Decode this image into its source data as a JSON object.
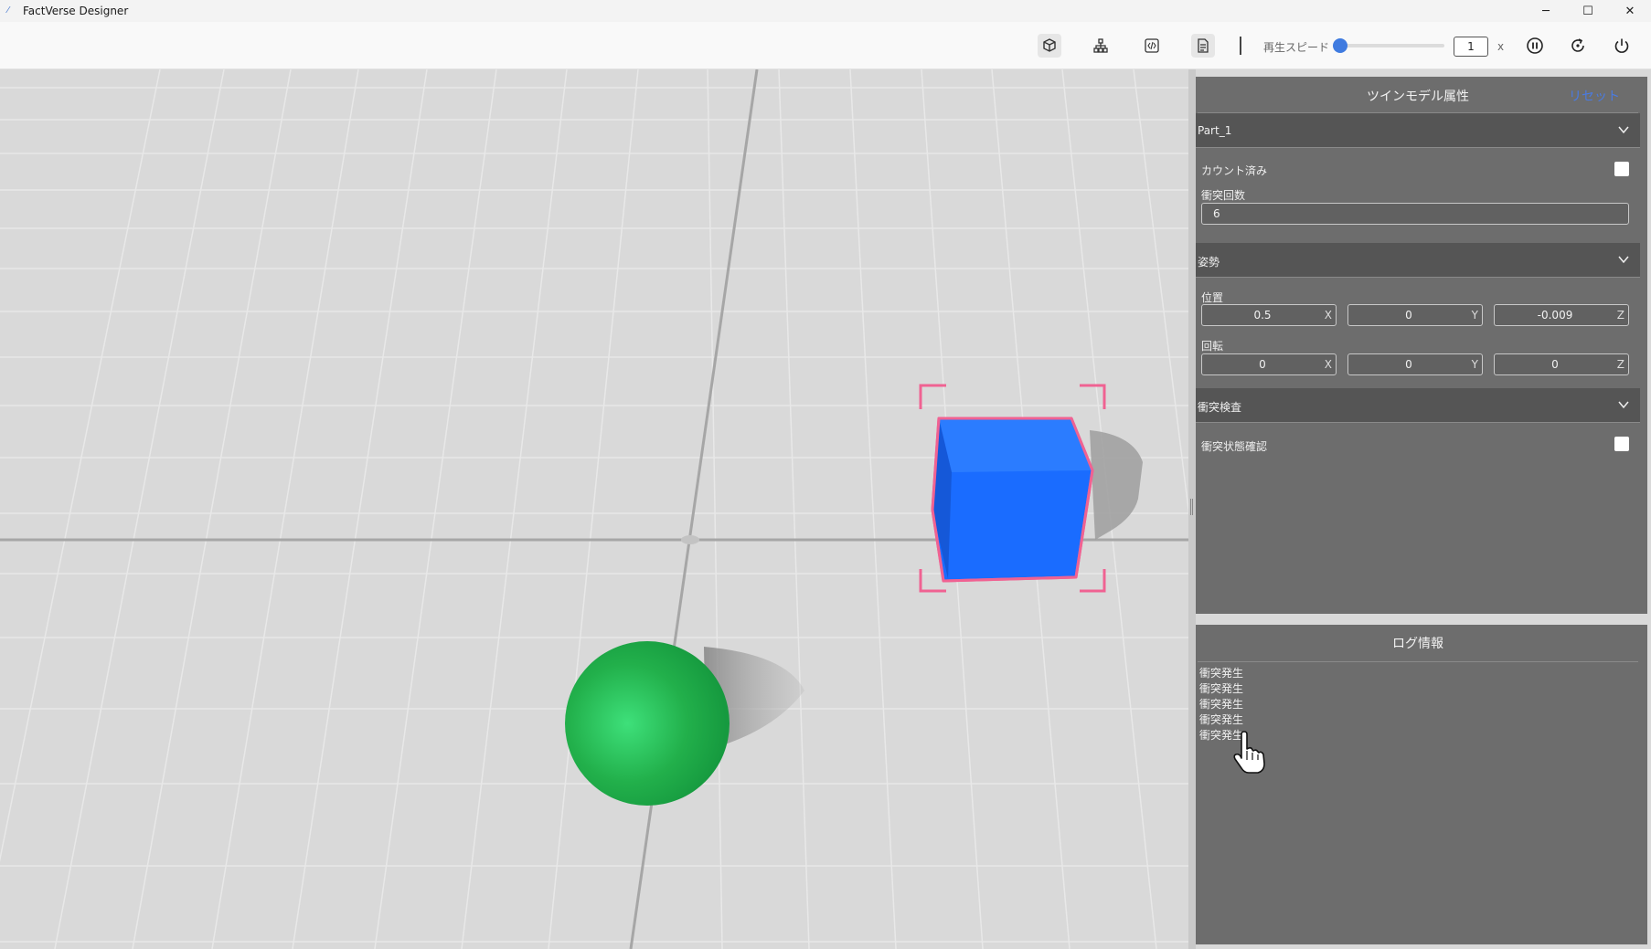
{
  "window": {
    "title": "FactVerse Designer",
    "icon": "factverse-logo-icon",
    "controls": {
      "minimize": "─",
      "maximize": "☐",
      "close": "✕"
    }
  },
  "toolbar": {
    "icons": [
      "cube-view-icon",
      "hierarchy-icon",
      "code-icon",
      "document-icon"
    ],
    "speed_label": "再生スピード",
    "speed_value": "1",
    "speed_unit": "x",
    "speed_slider_level": 0.0,
    "actions": [
      "pause-icon",
      "reset-icon",
      "power-icon"
    ]
  },
  "properties_panel": {
    "title": "ツインモデル属性",
    "reset_label": "リセット",
    "part_section": {
      "label": "Part_1",
      "counted_label": "カウント済み",
      "counted_checked": false,
      "collision_count_label": "衝突回数",
      "collision_count_value": "6"
    },
    "pose_section": {
      "label": "姿勢",
      "position_label": "位置",
      "position": {
        "x": "0.5",
        "y": "0",
        "z": "-0.009"
      },
      "rotation_label": "回転",
      "rotation": {
        "x": "0",
        "y": "0",
        "z": "0"
      },
      "axis_labels": {
        "x": "X",
        "y": "Y",
        "z": "Z"
      }
    },
    "collision_section": {
      "label": "衝突検査",
      "check_label": "衝突状態確認",
      "check_checked": false
    }
  },
  "log_panel": {
    "title": "ログ情報",
    "lines": [
      "衝突発生",
      "衝突発生",
      "衝突発生",
      "衝突発生",
      "衝突発生"
    ]
  },
  "scene": {
    "objects": [
      "green-sphere",
      "blue-cube"
    ],
    "selected": "blue-cube",
    "colors": {
      "sphere": "#22b04b",
      "cube": "#1a6cff",
      "selection": "#f06292",
      "ground": "#d9d9d9"
    }
  }
}
